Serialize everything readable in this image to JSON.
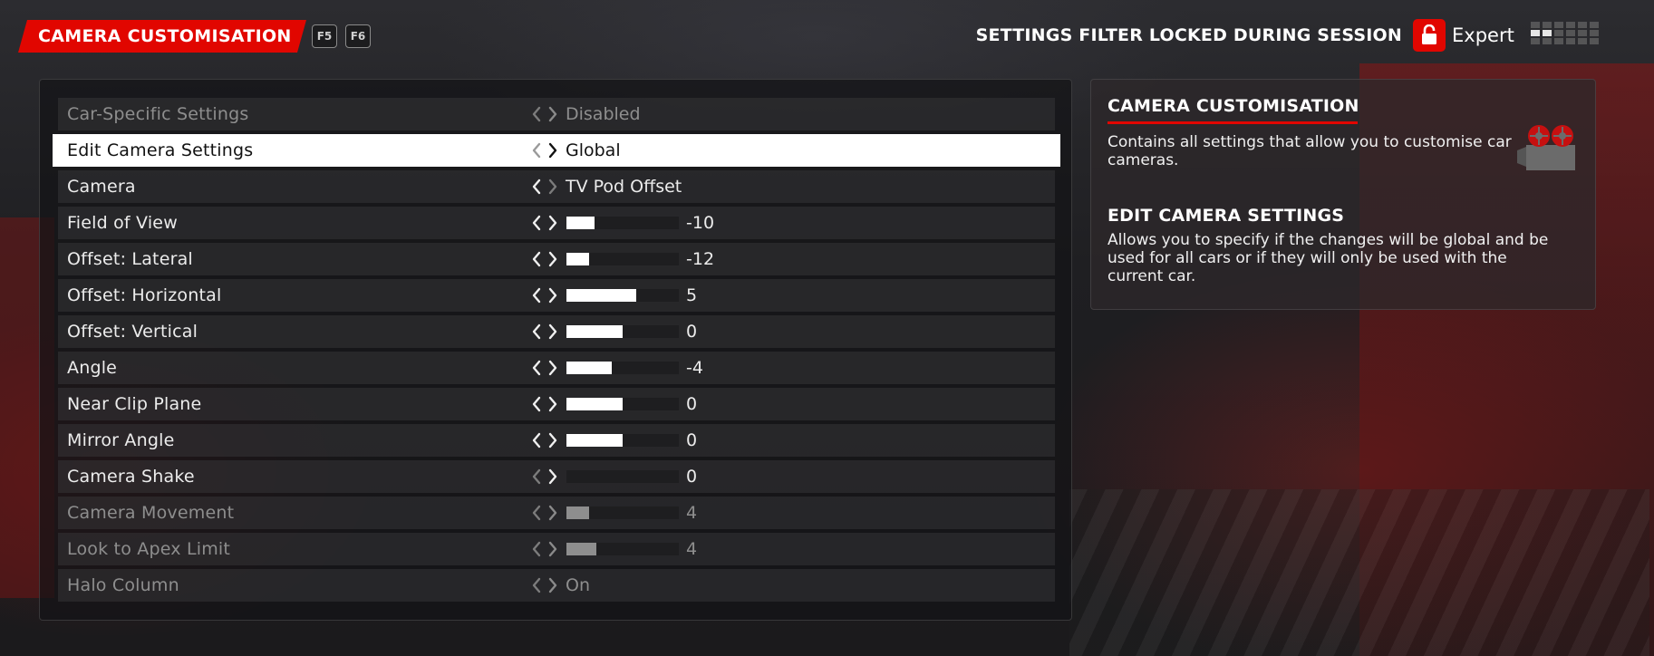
{
  "header": {
    "title": "CAMERA CUSTOMISATION",
    "fkeys": [
      "F5",
      "F6"
    ],
    "filter_text": "SETTINGS FILTER LOCKED DURING SESSION",
    "difficulty": "Expert",
    "lock_icon": "lock-icon",
    "brand_color": "#e10600"
  },
  "settings": [
    {
      "label": "Car-Specific Settings",
      "type": "text",
      "value": "Disabled",
      "state": "dim"
    },
    {
      "label": "Edit Camera Settings",
      "type": "text",
      "value": "Global",
      "state": "selected"
    },
    {
      "label": "Camera",
      "type": "text",
      "value": "TV Pod Offset",
      "state": "normal"
    },
    {
      "label": "Field of View",
      "type": "slider",
      "value": "-10",
      "level": 0.25,
      "state": "normal"
    },
    {
      "label": "Offset: Lateral",
      "type": "slider",
      "value": "-12",
      "level": 0.2,
      "state": "normal"
    },
    {
      "label": "Offset: Horizontal",
      "type": "slider",
      "value": "5",
      "level": 0.62,
      "state": "normal"
    },
    {
      "label": "Offset: Vertical",
      "type": "slider",
      "value": "0",
      "level": 0.5,
      "state": "normal"
    },
    {
      "label": "Angle",
      "type": "slider",
      "value": "-4",
      "level": 0.4,
      "state": "normal"
    },
    {
      "label": "Near Clip Plane",
      "type": "slider",
      "value": "0",
      "level": 0.5,
      "state": "normal"
    },
    {
      "label": "Mirror Angle",
      "type": "slider",
      "value": "0",
      "level": 0.5,
      "state": "normal"
    },
    {
      "label": "Camera Shake",
      "type": "slider",
      "value": "0",
      "level": 0.0,
      "state": "normal"
    },
    {
      "label": "Camera Movement",
      "type": "slider",
      "value": "4",
      "level": 0.2,
      "state": "dim"
    },
    {
      "label": "Look to Apex Limit",
      "type": "slider",
      "value": "4",
      "level": 0.27,
      "state": "dim"
    },
    {
      "label": "Halo Column",
      "type": "text",
      "value": "On",
      "state": "dim"
    }
  ],
  "info": {
    "section1_title": "CAMERA CUSTOMISATION",
    "section1_body": "Contains all settings that allow you to customise car cameras.",
    "section2_title": "EDIT CAMERA SETTINGS",
    "section2_body": "Allows you to specify if the changes will be global and be used for all cars or if they will only be used with the current car.",
    "icon": "camera-icon"
  }
}
